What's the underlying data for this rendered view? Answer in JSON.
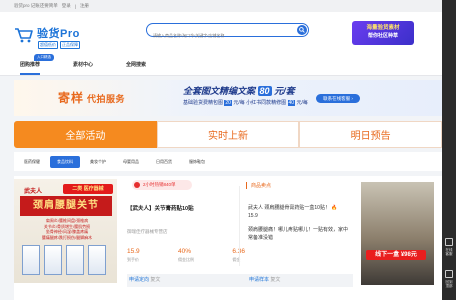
{
  "topbar": {
    "items": [
      "验货pro 记账还要简单",
      "登录",
      "注册"
    ]
  },
  "brand": {
    "name": "验货Pro",
    "tags": [
      "超值低价",
      "正品保障"
    ]
  },
  "search": {
    "placeholder": "请输入商品名称/淘口令/关键字/店铺名称"
  },
  "ad_right": {
    "line1": "海量验货素材",
    "line2": "帮你社区种草"
  },
  "nav": {
    "badge": "入口精选",
    "items": [
      "团购推荐",
      "素材中心",
      "全网搜索"
    ]
  },
  "banner": {
    "left_main": "寄样",
    "left_sub": "代拍服务",
    "headline_pre": "全套图文精编文案",
    "headline_num": "80",
    "headline_post": "元/套",
    "sub_pre": "基础验货费精包图",
    "sub_price1": "20",
    "sub_mid": "元/每 小红书同款精修图",
    "sub_price2": "40",
    "sub_post": "元/每",
    "button": "联系在线客服 ›"
  },
  "tabs": [
    "全部活动",
    "实时上新",
    "明日预告"
  ],
  "subtabs": [
    "医药保健",
    "食品饮料",
    "美妆个护",
    "母婴用品",
    "日用百货",
    "服饰鞋包"
  ],
  "product": {
    "brand": "武夫人",
    "tag": "二类 医疗器械",
    "title": "颈肩腰腿关节",
    "lines": [
      "肩周炎/腰椎间盘/颈椎病",
      "关节炎/骨质增生/腰肌劳损",
      "坐骨神经/风湿/膝盖疼痛",
      "腰痛腿疼/跌打损伤/腿脚麻木"
    ],
    "live_badge": "2小时热销840单",
    "item_title": "【武夫人】关节膏药贴10贴",
    "shop": "御瑞佳疗器械专营店",
    "stats": [
      {
        "value": "15.9",
        "label": "到手价"
      },
      {
        "value": "40%",
        "label": "佣金比例"
      },
      {
        "value": "6.36",
        "label": "佣金"
      }
    ],
    "apply_label": "申请定向",
    "apply_extra": "复文",
    "apply_label2": "申请样本",
    "apply_extra2": "复文"
  },
  "copy": {
    "header": "商品卖点",
    "body1": "武夫人 颈肩腰腿骨膏药贴一盒10贴！ 🔥 15.9",
    "body2": "颈肩腰腿痛！哪儿疼贴哪儿！一贴有效，家中常备准没错"
  },
  "right_image": {
    "price_text": "线下一盒 ¥98元"
  },
  "rail": {
    "items": [
      "在线客服",
      "回到顶部"
    ]
  },
  "colors": {
    "accent": "#2a6fdb",
    "orange": "#f58a1f",
    "red": "#e62e2e"
  }
}
